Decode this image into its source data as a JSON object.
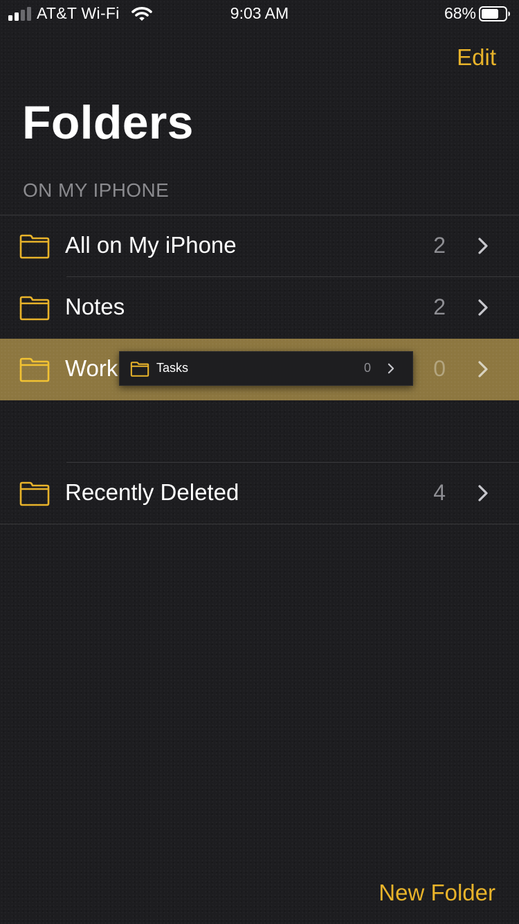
{
  "status_bar": {
    "carrier": "AT&T Wi-Fi",
    "time": "9:03 AM",
    "battery_percent": "68%"
  },
  "nav": {
    "edit_label": "Edit",
    "title": "Folders"
  },
  "section": {
    "header": "ON MY IPHONE"
  },
  "folders": [
    {
      "label": "All on My iPhone",
      "count": "2",
      "icon": "folder-icon"
    },
    {
      "label": "Notes",
      "count": "2",
      "icon": "folder-icon"
    },
    {
      "label": "Work",
      "count": "0",
      "icon": "folder-icon",
      "highlighted": true
    },
    {
      "label": "Recently Deleted",
      "count": "4",
      "icon": "folder-icon"
    }
  ],
  "drag_preview": {
    "label": "Tasks",
    "count": "0",
    "icon": "folder-icon"
  },
  "toolbar": {
    "new_folder_label": "New Folder"
  },
  "colors": {
    "accent": "#e8b32a",
    "background": "#1d1d20",
    "highlight": "#8d7740",
    "secondary_text": "#8e8e93"
  }
}
